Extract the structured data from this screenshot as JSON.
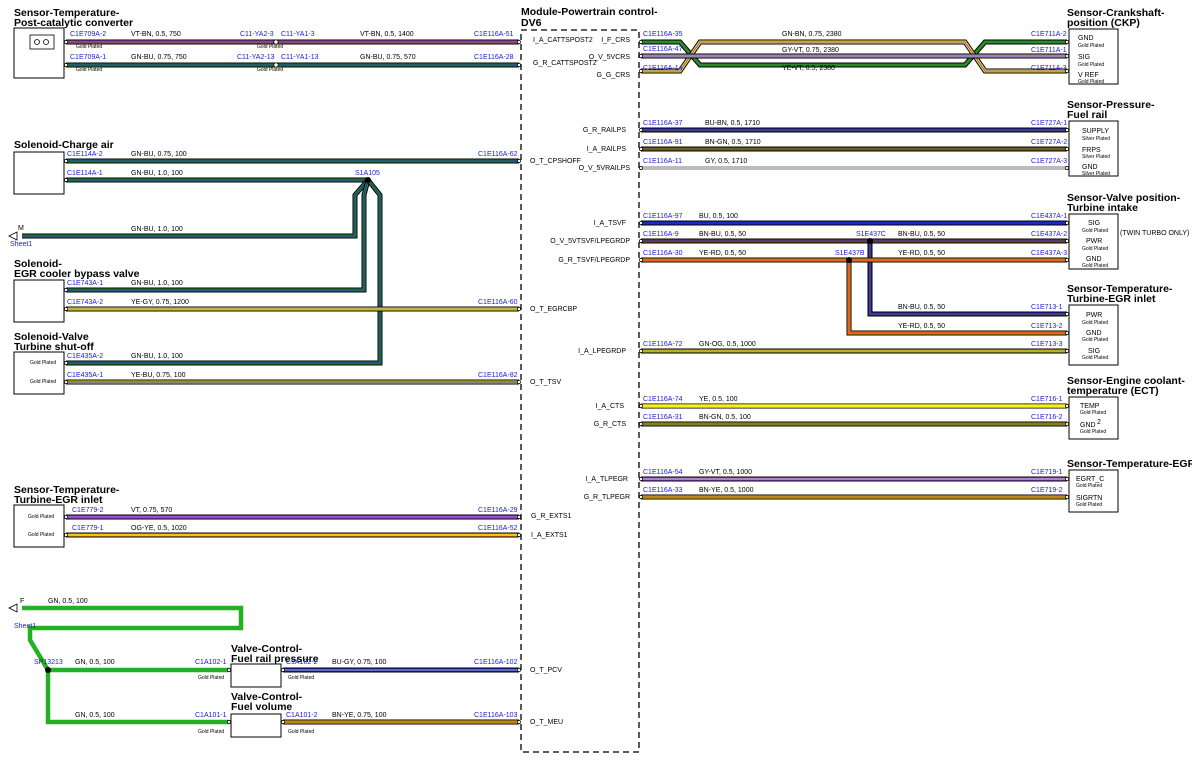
{
  "module": {
    "title_line1": "Module-Powertrain control-",
    "title_line2": "DV6"
  },
  "texts": {
    "plating_gold": "Gold Plated",
    "plating_silver": "Silver Plated",
    "twin_turbo_note": "(TWIN TURBO ONLY)",
    "sheet_label": "Sheet1",
    "off_m": "M",
    "off_f": "F"
  },
  "components": {
    "post_cat": {
      "line1": "Sensor-Temperature-",
      "line2": "Post-catalytic converter"
    },
    "charge_air": {
      "line1": "Solenoid-Charge air"
    },
    "egr_bypass": {
      "line1": "Solenoid-",
      "line2": "EGR cooler bypass valve"
    },
    "turbine_shutoff": {
      "line1": "Solenoid-Valve",
      "line2": "Turbine shut-off"
    },
    "turbine_egr_inlet_left": {
      "line1": "Sensor-Temperature-",
      "line2": "Turbine-EGR inlet"
    },
    "fuel_rail_pressure_valve": {
      "line1": "Valve-Control-",
      "line2": "Fuel rail pressure"
    },
    "fuel_volume_valve": {
      "line1": "Valve-Control-",
      "line2": "Fuel volume"
    },
    "ckp": {
      "line1": "Sensor-Crankshaft-",
      "line2": "position (CKP)",
      "pins": [
        "GND",
        "SIG",
        "V REF"
      ]
    },
    "fuel_rail_sensor": {
      "line1": "Sensor-Pressure-",
      "line2": "Fuel rail",
      "pins": [
        "SUPPLY",
        "FRPS",
        "GND"
      ]
    },
    "valve_position": {
      "line1": "Sensor-Valve position-",
      "line2": "Turbine intake",
      "pins": [
        "SIG",
        "PWR",
        "GND"
      ]
    },
    "turbine_egr_inlet_right": {
      "line1": "Sensor-Temperature-",
      "line2": "Turbine-EGR inlet",
      "pins": [
        "PWR",
        "GND",
        "SIG"
      ]
    },
    "ect": {
      "line1": "Sensor-Engine coolant-",
      "line2": "temperature (ECT)",
      "pins": [
        "TEMP",
        "GND"
      ],
      "extra": "2"
    },
    "egr_sensor": {
      "line1": "Sensor-Temperature-EGR",
      "pins": [
        "EGRT_C",
        "SIGRTN"
      ]
    }
  },
  "left_signals": {
    "cattspost2_i": "I_A_CATTSPOST2",
    "cattspost2_g": "G_R_CATTSPOST2",
    "cpshoff": "O_T_CPSHOFF",
    "egrcbp": "O_T_EGRCBP",
    "tsv": "O_T_TSV",
    "exts1_g": "G_R_EXTS1",
    "exts1_i": "I_A_EXTS1",
    "pcv": "O_T_PCV",
    "meu": "O_T_MEU"
  },
  "right_signals": {
    "crs_i": "I_F_CRS",
    "vcrs": "O_V_5VCRS",
    "crs_g": "G_G_CRS",
    "railps_g": "G_R_RAILPS",
    "railps_i": "I_A_RAILPS",
    "railps_o": "O_V_5VRAILPS",
    "tsvf": "I_A_TSVF",
    "tsvf_5v": "O_V_5VTSVF/LPEGRDP",
    "tsvf_g": "G_R_TSVF/LPEGRDP",
    "lpegrdp": "I_A_LPEGRDP",
    "cts_i": "I_A_CTS",
    "cts_g": "G_R_CTS",
    "tlpegr_i": "I_A_TLPEGR",
    "tlpegr_g": "G_R_TLPEGR"
  },
  "connectors": {
    "c1e709a_2": "C1E709A-2",
    "c1e709a_1": "C1E709A-1",
    "c11ya2_3": "C11-YA2-3",
    "c11ya1_3": "C11-YA1-3",
    "c11ya2_13": "C11-YA2-13",
    "c11ya1_13": "C11-YA1-13",
    "c1e116a_51": "C1E116A-51",
    "c1e116a_28": "C1E116A-28",
    "c1e114a_2": "C1E114A-2",
    "c1e114a_1": "C1E114A-1",
    "c1e116a_62": "C1E116A-62",
    "s1a105": "S1A105",
    "c1e743a_1": "C1E743A-1",
    "c1e743a_2": "C1E743A-2",
    "c1e116a_60": "C1E116A-60",
    "c1e435a_2": "C1E435A-2",
    "c1e435a_1": "C1E435A-1",
    "c1e116a_82": "C1E116A-82",
    "c1e779_2": "C1E779-2",
    "c1e779_1": "C1E779-1",
    "c1e116a_29": "C1E116A-29",
    "c1e116a_52": "C1E116A-52",
    "sp13213": "SP13213",
    "c1a102_1": "C1A102-1",
    "c1a102_2": "C1A102-2",
    "c1e116a_102": "C1E116A-102",
    "c1a101_1": "C1A101-1",
    "c1a101_2": "C1A101-2",
    "c1e116a_103": "C1E116A-103",
    "c1e116a_35": "C1E116A-35",
    "c1e116a_47": "C1E116A-47",
    "c1e116a_14": "C1E116A-14",
    "c1e711a_2": "C1E711A-2",
    "c1e711a_1": "C1E711A-1",
    "c1e711a_3": "C1E711A-3",
    "c1e116a_37": "C1E116A-37",
    "c1e116a_91": "C1E116A-91",
    "c1e116a_11": "C1E116A-11",
    "c1e727a_1": "C1E727A-1",
    "c1e727a_2": "C1E727A-2",
    "c1e727a_3": "C1E727A-3",
    "c1e116a_97": "C1E116A-97",
    "c1e116a_9": "C1E116A-9",
    "c1e116a_30": "C1E116A-30",
    "c1e437a_1": "C1E437A-1",
    "c1e437a_2": "C1E437A-2",
    "c1e437a_3": "C1E437A-3",
    "s1e437c": "S1E437C",
    "s1e437b": "S1E437B",
    "c1e713_1": "C1E713-1",
    "c1e713_2": "C1E713-2",
    "c1e713_3": "C1E713-3",
    "c1e116a_72": "C1E116A-72",
    "c1e116a_74": "C1E116A-74",
    "c1e116a_31": "C1E116A-31",
    "c1e716_1": "C1E716-1",
    "c1e716_2": "C1E716-2",
    "c1e116a_54": "C1E116A-54",
    "c1e116a_33": "C1E116A-33",
    "c1e719_1": "C1E719-1",
    "c1e719_2": "C1E719-2"
  },
  "wires": {
    "w1a": "VT-BN,  0.5,  750",
    "w1b": "VT-BN,  0.5,  1400",
    "w2a": "GN-BU,  0.75,  750",
    "w2b": "GN-BU,  0.75,  570",
    "w3": "GN-BU,  0.75,  100",
    "w4": "GN-BU,  1.0,  100",
    "w5": "GN-BU,  1.0,  100",
    "w6": "GN-BU,  1.0,  100",
    "w7": "YE-GY,  0.75,  1200",
    "w8": "GN-BU,  1.0,  100",
    "w9": "YE-BU,  0.75,  100",
    "w10": "VT,  0.75,  570",
    "w11": "OG-YE,  0.5,  1020",
    "w12": "GN,  0.5,  100",
    "w13": "GN,  0.5,  100",
    "w14": "BU-GY,  0.75,  100",
    "w15": "GN,  0.5,  100",
    "w16": "BN-YE,  0.75,  100",
    "r1": "GN-BN,  0.75,  2380",
    "r2": "GY-VT,  0.75,  2380",
    "r3": "YE-VT,  0.5,  2380",
    "r4": "BU-BN,  0.5,  1710",
    "r5": "BN-GN,  0.5,  1710",
    "r6": "GY,  0.5,  1710",
    "r7": "BU,  0.5,  100",
    "r8a": "BN-BU,  0.5,  50",
    "r8b": "BN-BU,  0.5,  50",
    "r9a": "YE-RD,  0.5,  50",
    "r9b": "YE-RD,  0.5,  50",
    "r10": "BN-BU,  0.5,  50",
    "r11": "YE-RD,  0.5,  50",
    "r12": "GN-OG,  0.5,  1000",
    "r13": "YE,  0.5,  100",
    "r14": "BN-GN,  0.5,  100",
    "r15": "GY-VT,  0.5,  1000",
    "r16": "BN-YE,  0.5,  1000"
  }
}
